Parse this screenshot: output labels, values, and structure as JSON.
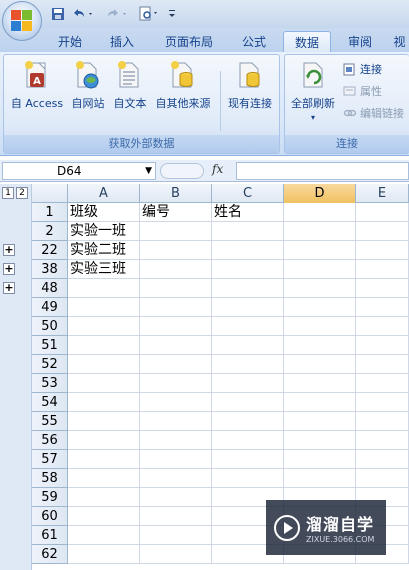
{
  "ribbon_tabs": [
    "开始",
    "插入",
    "页面布局",
    "公式",
    "数据",
    "审阅",
    "视"
  ],
  "active_tab": "数据",
  "external_data_group": {
    "label": "获取外部数据",
    "buttons": [
      "自 Access",
      "自网站",
      "自文本",
      "自其他来源",
      "现有连接"
    ]
  },
  "connections_group": {
    "label": "连接",
    "refresh_all": "全部刷新",
    "connections": "连接",
    "properties": "属性",
    "edit_links": "编辑链接"
  },
  "formula_bar": {
    "name_box": "D64",
    "fx_label": "fx",
    "formula": ""
  },
  "outline_levels": [
    "1",
    "2"
  ],
  "column_headers": [
    "A",
    "B",
    "C",
    "D",
    "E"
  ],
  "selected_column": "D",
  "rows": [
    {
      "num": "1",
      "a": "班级",
      "b": "编号",
      "c": "姓名"
    },
    {
      "num": "2",
      "a": "实验一班",
      "b": "",
      "c": ""
    },
    {
      "num": "22",
      "a": "实验二班",
      "b": "",
      "c": ""
    },
    {
      "num": "38",
      "a": "实验三班",
      "b": "",
      "c": ""
    },
    {
      "num": "48",
      "a": "",
      "b": "",
      "c": ""
    },
    {
      "num": "49",
      "a": "",
      "b": "",
      "c": ""
    },
    {
      "num": "50",
      "a": "",
      "b": "",
      "c": ""
    },
    {
      "num": "51",
      "a": "",
      "b": "",
      "c": ""
    },
    {
      "num": "52",
      "a": "",
      "b": "",
      "c": ""
    },
    {
      "num": "53",
      "a": "",
      "b": "",
      "c": ""
    },
    {
      "num": "54",
      "a": "",
      "b": "",
      "c": ""
    },
    {
      "num": "55",
      "a": "",
      "b": "",
      "c": ""
    },
    {
      "num": "56",
      "a": "",
      "b": "",
      "c": ""
    },
    {
      "num": "57",
      "a": "",
      "b": "",
      "c": ""
    },
    {
      "num": "58",
      "a": "",
      "b": "",
      "c": ""
    },
    {
      "num": "59",
      "a": "",
      "b": "",
      "c": ""
    },
    {
      "num": "60",
      "a": "",
      "b": "",
      "c": ""
    },
    {
      "num": "61",
      "a": "",
      "b": "",
      "c": ""
    },
    {
      "num": "62",
      "a": "",
      "b": "",
      "c": ""
    }
  ],
  "expand_symbol": "+",
  "watermark": {
    "title": "溜溜自学",
    "url": "ZIXUE.3066.COM"
  }
}
